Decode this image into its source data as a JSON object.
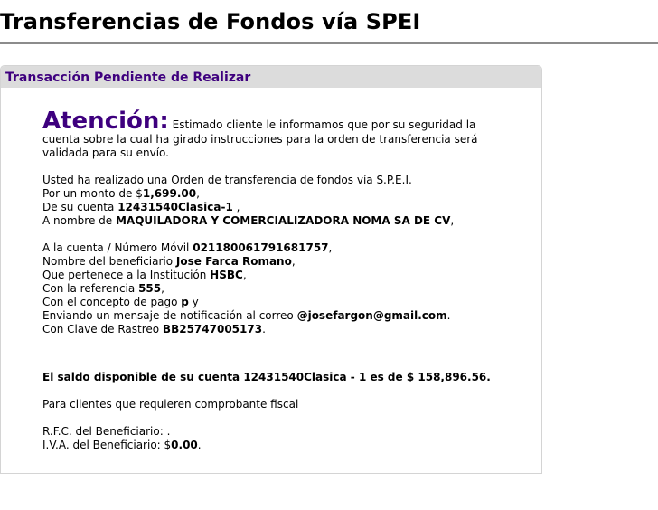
{
  "page_title": "Transferencias de Fondos vía SPEI",
  "panel": {
    "title": "Transacción Pendiente de Realizar",
    "attention_heading": "Atención:",
    "attention_text": "Estimado cliente le informamos que por su seguridad la cuenta sobre la cual ha girado instrucciones para la orden de transferencia será validada para su envío."
  },
  "order": {
    "intro": "Usted ha realizado una Orden de transferencia de fondos vía S.P.E.I.",
    "amount_prefix": "Por un monto de $",
    "amount": "1,699.00",
    "amount_suffix": ",",
    "account_prefix": "De su cuenta ",
    "account": "12431540Clasica-1",
    "account_suffix": " ,",
    "holder_prefix": "A nombre de ",
    "holder": "MAQUILADORA Y COMERCIALIZADORA NOMA SA DE CV",
    "holder_suffix": ","
  },
  "beneficiary": {
    "dest_prefix": "A la cuenta / Número Móvil ",
    "dest_account": "021180061791681757",
    "dest_suffix": ",",
    "name_prefix": "Nombre del beneficiario ",
    "name": "Jose Farca Romano",
    "name_suffix": ",",
    "bank_prefix": "Que pertenece a la Institución ",
    "bank": "HSBC",
    "bank_suffix": ",",
    "ref_prefix": "Con la referencia ",
    "reference": "555",
    "ref_suffix": ",",
    "concept_prefix": "Con el concepto de pago ",
    "concept": "p",
    "concept_suffix": " y",
    "email_prefix": "Enviando un mensaje de notificación al correo ",
    "email": "@josefargon@gmail.com",
    "email_suffix": ".",
    "tracking_prefix": "Con Clave de Rastreo ",
    "tracking": "BB25747005173",
    "tracking_suffix": "."
  },
  "balance_text": "El saldo disponible de su cuenta 12431540Clasica - 1 es de $ 158,896.56.",
  "fiscal": {
    "intro": "Para clientes que requieren comprobante fiscal",
    "rfc_prefix": "R.F.C. del Beneficiario: ",
    "rfc": ".",
    "iva_prefix": "I.V.A. del Beneficiario: $",
    "iva": "0.00",
    "iva_suffix": "."
  }
}
